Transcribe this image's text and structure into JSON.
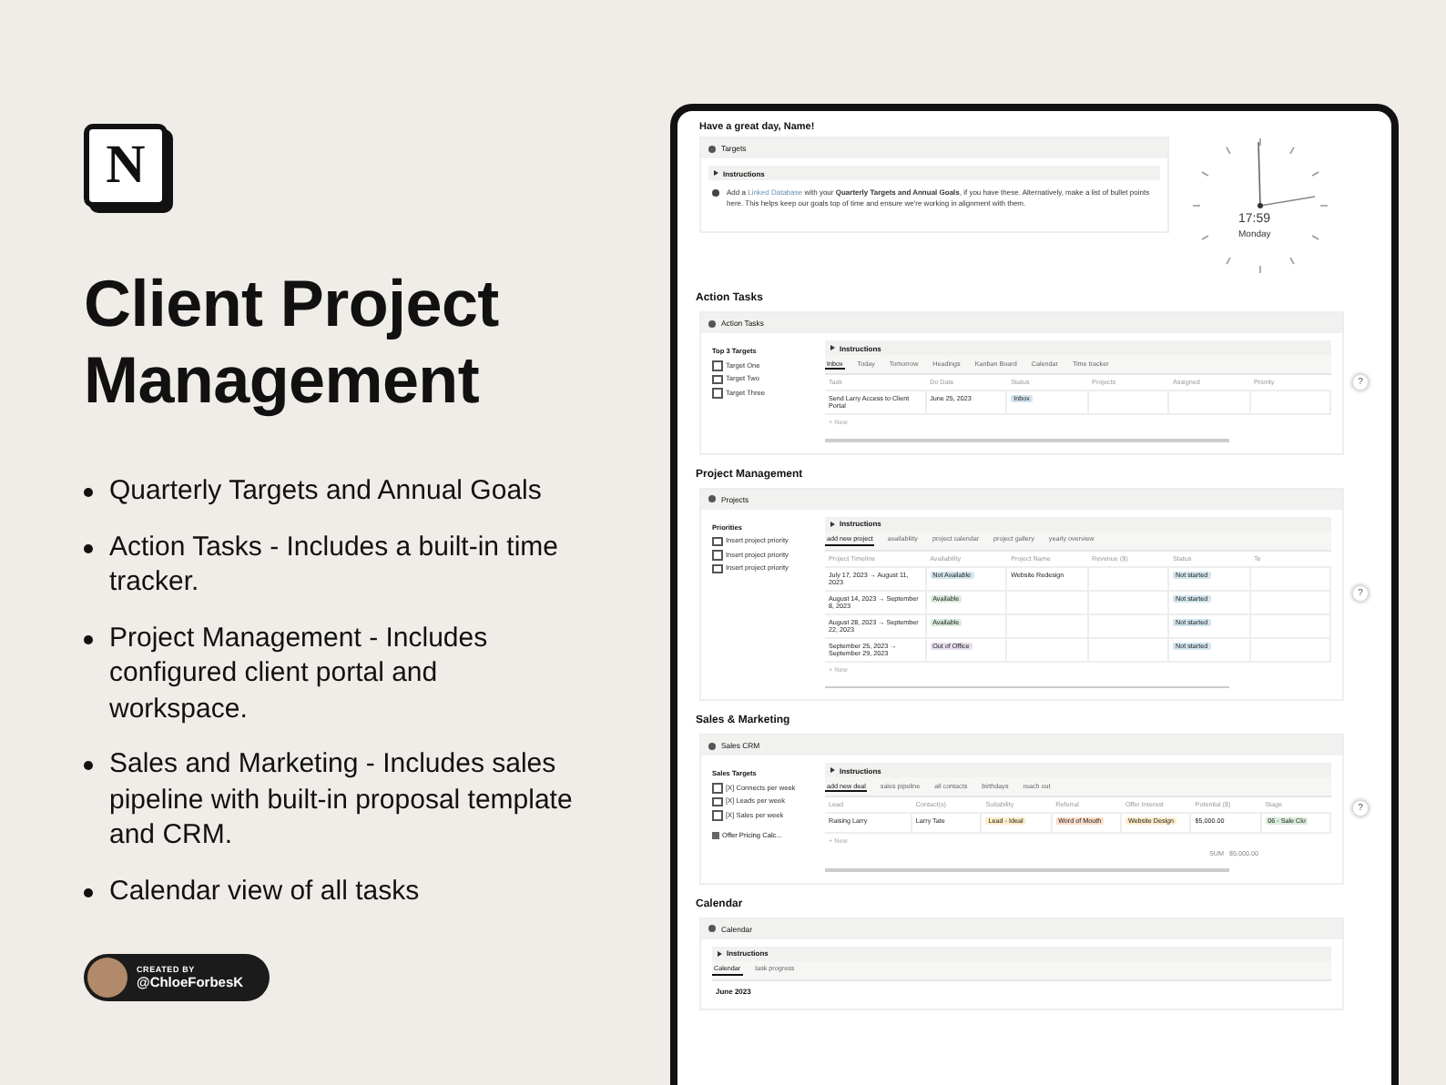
{
  "logo": {
    "letter": "N"
  },
  "title": "Client Project Management",
  "features": [
    "Quarterly Targets and Annual Goals",
    "Action Tasks - Includes a built-in time tracker.",
    "Project Management - Includes configured client portal and workspace.",
    "Sales and Marketing - Includes sales pipeline with built-in proposal template and CRM.",
    "Calendar view of all tasks"
  ],
  "creator": {
    "label": "CREATED BY",
    "handle": "@ChloeForbesK"
  },
  "page": {
    "greeting": "Have a great day, Name!",
    "targets": {
      "title": "Targets",
      "toggle": "Instructions",
      "note_start": "Add a",
      "note_link": "Linked Database",
      "note_rest": "with your **Quarterly Targets and Annual Goals**, if you have these. Alternatively, make a list of bullet points here.  This helps keep our goals top of time and ensure we're working in alignment with them."
    },
    "clock": {
      "time": "17:59",
      "day": "Monday"
    },
    "sections": [
      {
        "heading": "Action Tasks",
        "block_title": "Action Tasks",
        "help": "?",
        "side_title": "Top 3 Targets",
        "side_items": [
          {
            "label": "Target One",
            "checked": false
          },
          {
            "label": "Target Two",
            "checked": false
          },
          {
            "label": "Target Three",
            "checked": false
          }
        ],
        "toggle": "Instructions",
        "views": [
          {
            "label": "Inbox",
            "selected": true
          },
          {
            "label": "Today",
            "selected": false
          },
          {
            "label": "Tomorrow",
            "selected": false
          },
          {
            "label": "Headings",
            "selected": false
          },
          {
            "label": "Kanban Board",
            "selected": false
          },
          {
            "label": "Calendar",
            "selected": false
          },
          {
            "label": "Time tracker",
            "selected": false
          }
        ],
        "columns": [
          "Task",
          "Do Date",
          "Status",
          "Projects",
          "Assigned",
          "Priority"
        ],
        "rows": [
          [
            {
              "text": "Send Larry Access to Client Portal"
            },
            {
              "text": "June 25, 2023"
            },
            {
              "text": "Inbox",
              "color": "#d3e5ef"
            },
            null,
            null,
            null
          ]
        ],
        "new_label": "+ New"
      },
      {
        "heading": "Project Management",
        "block_title": "Projects",
        "help": "?",
        "side_title": "Priorities",
        "side_items": [
          {
            "label": "Insert project priority",
            "checked": false
          },
          {
            "label": "Insert project priority",
            "checked": false
          },
          {
            "label": "Insert project priority",
            "checked": false
          }
        ],
        "toggle": "Instructions",
        "views": [
          {
            "label": "add new project",
            "selected": true
          },
          {
            "label": "availability",
            "selected": false
          },
          {
            "label": "project calendar",
            "selected": false
          },
          {
            "label": "project gallery",
            "selected": false
          },
          {
            "label": "yearly overview",
            "selected": false
          }
        ],
        "columns": [
          "Project Timeline",
          "Availability",
          "Project Name",
          "Revenue ($)",
          "Status",
          "Te"
        ],
        "rows": [
          [
            {
              "text": "July 17, 2023 → August 11, 2023"
            },
            {
              "text": "Not Available",
              "color": "#d3e5ef"
            },
            {
              "text": "Website Redesign"
            },
            null,
            null,
            null
          ],
          [
            {
              "text": "August 14, 2023 → September 8, 2023"
            },
            {
              "text": "Available",
              "color": "#dbeddb"
            },
            null,
            null,
            {
              "text": "Not started",
              "color": "#d3e5ef"
            },
            null
          ],
          [
            {
              "text": "August 28, 2023 → September 22, 2023"
            },
            {
              "text": "Available",
              "color": "#dbeddb"
            },
            null,
            null,
            {
              "text": "Not started",
              "color": "#d3e5ef"
            },
            null
          ],
          [
            {
              "text": "September 25, 2023 → September 29, 2023"
            },
            {
              "text": "Out of Office",
              "color": "#e8deee"
            },
            null,
            null,
            {
              "text": "Not started",
              "color": "#d3e5ef"
            },
            null
          ]
        ],
        "status_first": {
          "text": "Not started",
          "color": "#d3e5ef"
        },
        "new_label": "+ New"
      },
      {
        "heading": "Sales & Marketing",
        "block_title": "Sales CRM",
        "help": "?",
        "side_title": "Sales Targets",
        "side_items": [
          {
            "label": "[X] Connects per week",
            "checked": false
          },
          {
            "label": "[X] Leads per week",
            "checked": false
          },
          {
            "label": "[X] Sales per week",
            "checked": false
          }
        ],
        "side_link": "Offer Pricing Calc...",
        "toggle": "Instructions",
        "views": [
          {
            "label": "add new deal",
            "selected": true
          },
          {
            "label": "sales pipeline",
            "selected": false
          },
          {
            "label": "all contacts",
            "selected": false
          },
          {
            "label": "birthdays",
            "selected": false
          },
          {
            "label": "reach out",
            "selected": false
          }
        ],
        "columns": [
          "Lead",
          "Contact(s)",
          "Suitability",
          "Referral",
          "Offer Interest",
          "Potential ($)",
          "Stage"
        ],
        "rows": [
          [
            {
              "text": "Raising Larry"
            },
            {
              "text": "Larry Tate"
            },
            {
              "text": "Lead - Ideal",
              "color": "#fdecc8"
            },
            {
              "text": "Word of Mouth",
              "color": "#fadec9"
            },
            {
              "text": "Website Design",
              "color": "#fdecc8"
            },
            {
              "text": "$5,000.00"
            },
            {
              "text": "06 - Sale Clo",
              "color": "#dbeddb"
            }
          ]
        ],
        "new_label": "+ New",
        "sum_label": "SUM",
        "sum": "$5,000.00"
      },
      {
        "heading": "Calendar",
        "block_title": "Calendar",
        "toggle": "Instructions",
        "views": [
          {
            "label": "Calendar",
            "selected": true
          },
          {
            "label": "task progress",
            "selected": false
          }
        ],
        "month": "June 2023"
      }
    ]
  }
}
